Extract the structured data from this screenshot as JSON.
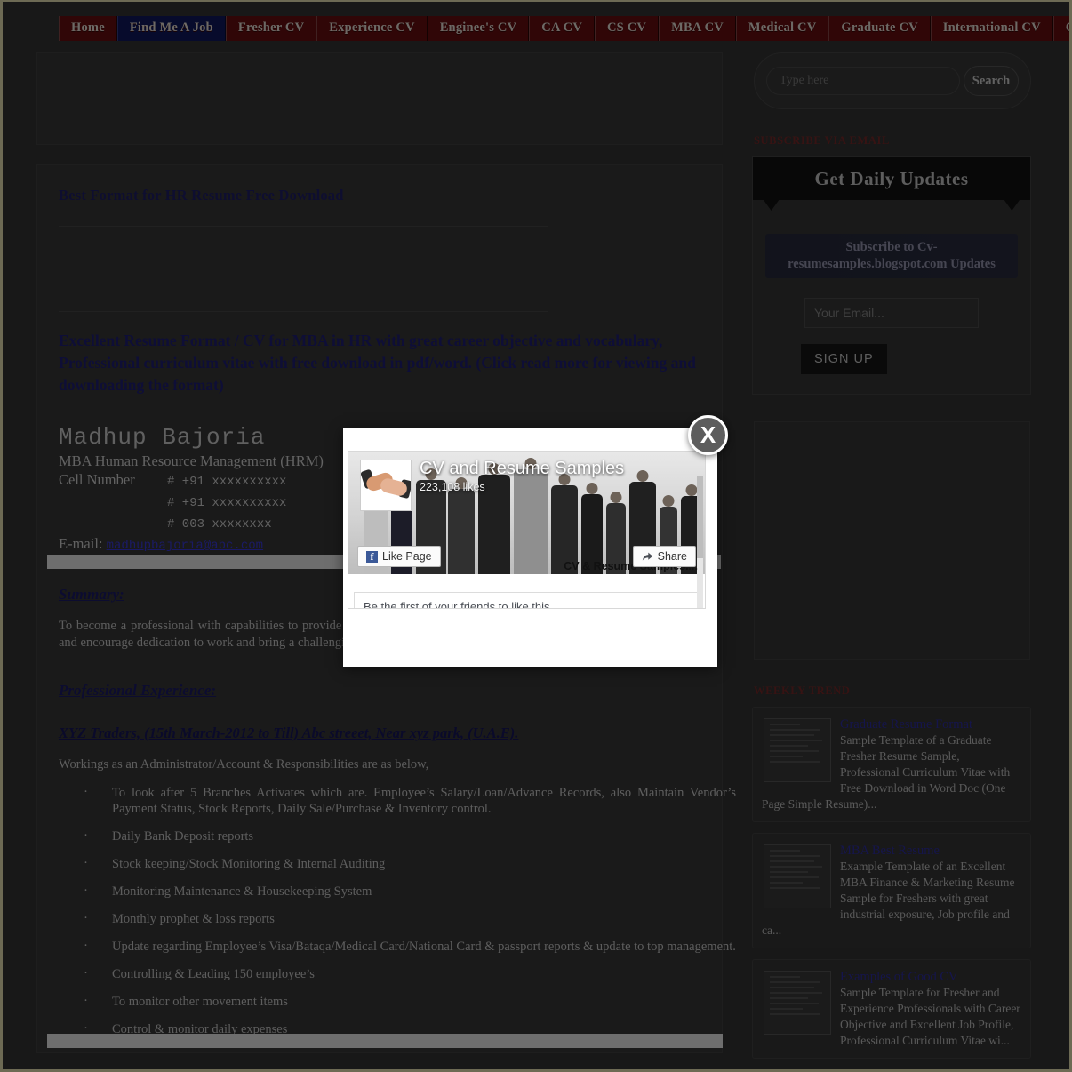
{
  "nav": {
    "items": [
      {
        "label": "Home",
        "active": false
      },
      {
        "label": "Find Me A Job",
        "active": true
      },
      {
        "label": "Fresher CV",
        "active": false
      },
      {
        "label": "Experience CV",
        "active": false
      },
      {
        "label": "Enginee's CV",
        "active": false
      },
      {
        "label": "CA CV",
        "active": false
      },
      {
        "label": "CS CV",
        "active": false
      },
      {
        "label": "MBA CV",
        "active": false
      },
      {
        "label": "Medical CV",
        "active": false
      },
      {
        "label": "Graduate CV",
        "active": false
      },
      {
        "label": "International CV",
        "active": false
      },
      {
        "label": "Other CVs",
        "active": false
      }
    ]
  },
  "article": {
    "post_title": "Best Format for HR Resume Free Download",
    "lede": "Excellent Resume Format / CV for MBA in HR with great career objective and vocabulary, Professional curriculum vitae with free download in pdf/word. (Click read more for viewing and downloading the format)",
    "resume": {
      "name": "Madhup Bajoria",
      "qualification": "MBA Human Resource Management (HRM)",
      "cell_label": "Cell Number",
      "phone1": "# +91 xxxxxxxxxx",
      "phone2": "# +91 xxxxxxxxxx",
      "phone3": "#   003 xxxxxxxx",
      "email_label": "E-mail:",
      "email": "madhupbajoria@abc.com"
    },
    "summary_heading": "Summary:",
    "summary_text": "To become a professional with capabilities to provide the best output to the organization, to support the teamwork efforts and encourage dedication to work and bring a challenging opportunity.",
    "experience_heading": "Professional Experience:",
    "job_heading": "XYZ Traders, (15th March-2012 to Till) Abc streeet, Near xyz park, (U.A.E).",
    "job_intro": "Workings as an Administrator/Account & Responsibilities are as below,",
    "duties": [
      "To look after 5 Branches Activates which are. Employee’s Salary/Loan/Advance Records, also Maintain Vendor’s Payment Status, Stock Reports, Daily Sale/Purchase & Inventory control.",
      "Daily Bank Deposit reports",
      "Stock keeping/Stock Monitoring & Internal Auditing",
      "Monitoring Maintenance & Housekeeping System",
      "Monthly prophet & loss reports",
      "Update regarding Employee’s Visa/Bataqa/Medical Card/National Card & passport reports & update to top management.",
      "Controlling & Leading 150 employee’s",
      "To monitor other movement items",
      "Control & monitor daily expenses"
    ]
  },
  "sidebar": {
    "search": {
      "placeholder": "Type here",
      "button_label": "Search"
    },
    "subscribe": {
      "section_heading": "SUBSCRIBE VIA EMAIL",
      "banner_title": "Get Daily Updates",
      "form_title": "Subscribe to Cv-resumesamples.blogspot.com Updates",
      "email_placeholder": "Your Email...",
      "signup_label": "SIGN UP"
    },
    "weekly_trend": {
      "heading": "WEEKLY TREND",
      "items": [
        {
          "title": "Graduate Resume Format",
          "desc": "Sample Template of a Graduate Fresher Resume Sample, Professional Curriculum Vitae with Free Download in Word Doc (One Page Simple Resume)..."
        },
        {
          "title": "MBA Best Resume",
          "desc": "Example Template of an Excellent MBA Finance & Marketing Resume Sample for Freshers with great industrial exposure, Job profile and ca..."
        },
        {
          "title": "Examples of Good CV",
          "desc": "Sample Template for Fresher and Experience Professionals with Career Objective and Excellent Job Profile, Professional Curriculum Vitae wi..."
        }
      ]
    }
  },
  "fb_popup": {
    "page_name": "CV and Resume Samples",
    "likes": "223,108 likes",
    "like_button": "Like Page",
    "share_button": "Share",
    "watermark": "CV & Resume Samples....",
    "friends_text": "Be the first of your friends to like this",
    "close_label": "X"
  },
  "colors": {
    "nav_red": "#6b0f10",
    "nav_active_blue": "#101a63",
    "link_blue": "#2f2fa8",
    "heading_maroon": "#7a2a2a",
    "page_bg": "#353535"
  }
}
